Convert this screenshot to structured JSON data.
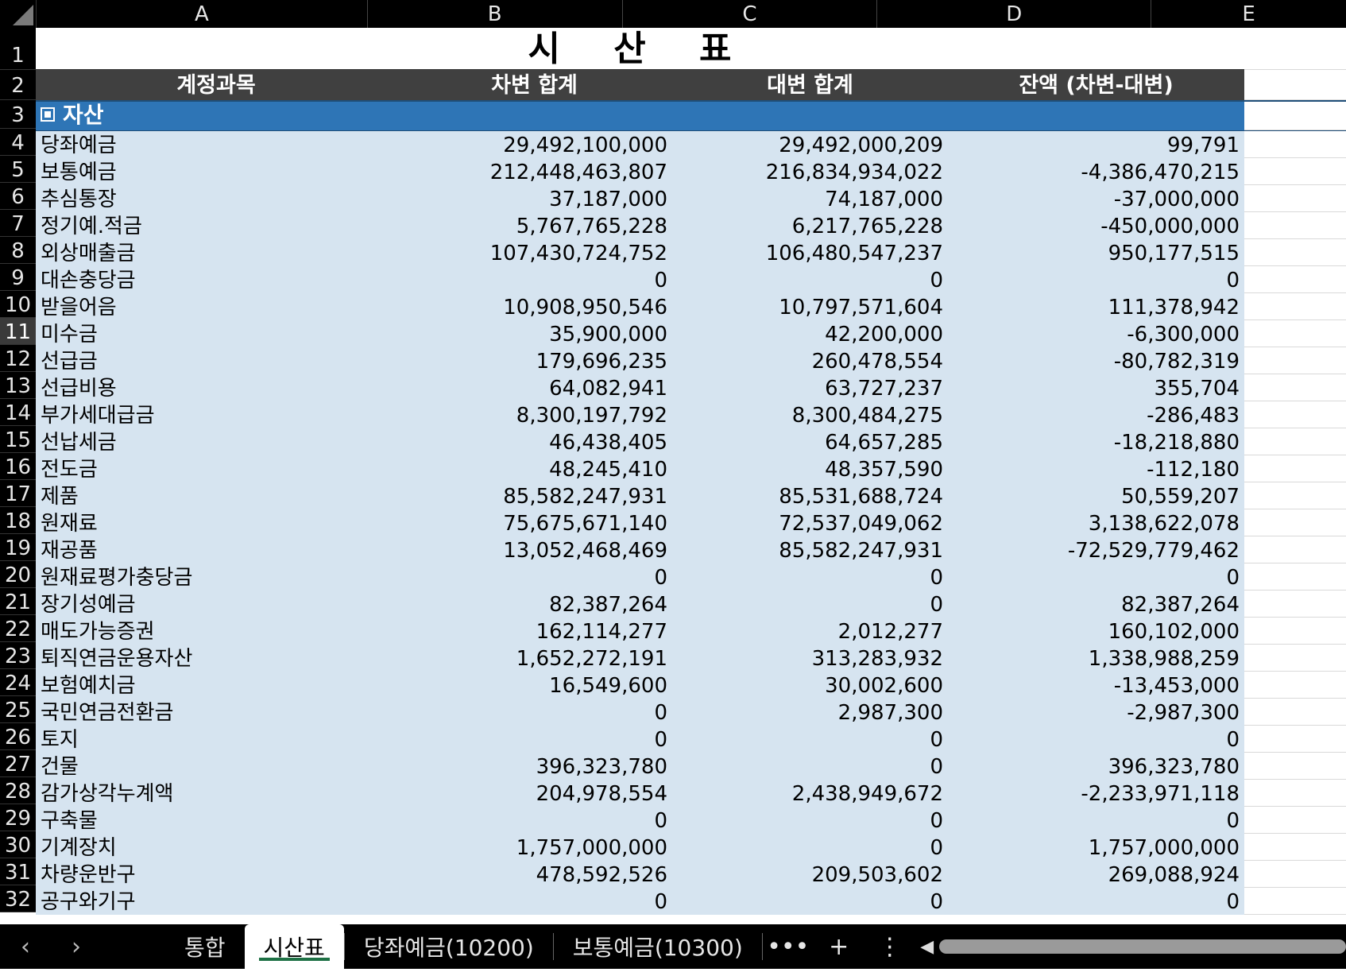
{
  "columns": [
    "A",
    "B",
    "C",
    "D",
    "E"
  ],
  "title": "시 산 표",
  "headers": {
    "account": "계정과목",
    "debit": "차변 합계",
    "credit": "대변 합계",
    "balance": "잔액 (차변-대변)"
  },
  "section_label": "자산",
  "selected_row": 11,
  "row_numbers": [
    1,
    2,
    3,
    4,
    5,
    6,
    7,
    8,
    9,
    10,
    11,
    12,
    13,
    14,
    15,
    16,
    17,
    18,
    19,
    20,
    21,
    22,
    23,
    24,
    25,
    26,
    27,
    28,
    29,
    30,
    31,
    32
  ],
  "rows": [
    {
      "account": "당좌예금",
      "debit": "29,492,100,000",
      "credit": "29,492,000,209",
      "balance": "99,791"
    },
    {
      "account": "보통예금",
      "debit": "212,448,463,807",
      "credit": "216,834,934,022",
      "balance": "-4,386,470,215"
    },
    {
      "account": "추심통장",
      "debit": "37,187,000",
      "credit": "74,187,000",
      "balance": "-37,000,000"
    },
    {
      "account": "정기예.적금",
      "debit": "5,767,765,228",
      "credit": "6,217,765,228",
      "balance": "-450,000,000"
    },
    {
      "account": "외상매출금",
      "debit": "107,430,724,752",
      "credit": "106,480,547,237",
      "balance": "950,177,515"
    },
    {
      "account": "대손충당금",
      "debit": "0",
      "credit": "0",
      "balance": "0"
    },
    {
      "account": "받을어음",
      "debit": "10,908,950,546",
      "credit": "10,797,571,604",
      "balance": "111,378,942"
    },
    {
      "account": "미수금",
      "debit": "35,900,000",
      "credit": "42,200,000",
      "balance": "-6,300,000"
    },
    {
      "account": "선급금",
      "debit": "179,696,235",
      "credit": "260,478,554",
      "balance": "-80,782,319"
    },
    {
      "account": "선급비용",
      "debit": "64,082,941",
      "credit": "63,727,237",
      "balance": "355,704"
    },
    {
      "account": "부가세대급금",
      "debit": "8,300,197,792",
      "credit": "8,300,484,275",
      "balance": "-286,483"
    },
    {
      "account": "선납세금",
      "debit": "46,438,405",
      "credit": "64,657,285",
      "balance": "-18,218,880"
    },
    {
      "account": "전도금",
      "debit": "48,245,410",
      "credit": "48,357,590",
      "balance": "-112,180"
    },
    {
      "account": "제품",
      "debit": "85,582,247,931",
      "credit": "85,531,688,724",
      "balance": "50,559,207"
    },
    {
      "account": "원재료",
      "debit": "75,675,671,140",
      "credit": "72,537,049,062",
      "balance": "3,138,622,078"
    },
    {
      "account": "재공품",
      "debit": "13,052,468,469",
      "credit": "85,582,247,931",
      "balance": "-72,529,779,462"
    },
    {
      "account": "원재료평가충당금",
      "debit": "0",
      "credit": "0",
      "balance": "0"
    },
    {
      "account": "장기성예금",
      "debit": "82,387,264",
      "credit": "0",
      "balance": "82,387,264"
    },
    {
      "account": "매도가능증권",
      "debit": "162,114,277",
      "credit": "2,012,277",
      "balance": "160,102,000"
    },
    {
      "account": "퇴직연금운용자산",
      "debit": "1,652,272,191",
      "credit": "313,283,932",
      "balance": "1,338,988,259"
    },
    {
      "account": "보험예치금",
      "debit": "16,549,600",
      "credit": "30,002,600",
      "balance": "-13,453,000"
    },
    {
      "account": "국민연금전환금",
      "debit": "0",
      "credit": "2,987,300",
      "balance": "-2,987,300"
    },
    {
      "account": "토지",
      "debit": "0",
      "credit": "0",
      "balance": "0"
    },
    {
      "account": "건물",
      "debit": "396,323,780",
      "credit": "0",
      "balance": "396,323,780"
    },
    {
      "account": "감가상각누계액",
      "debit": "204,978,554",
      "credit": "2,438,949,672",
      "balance": "-2,233,971,118"
    },
    {
      "account": "구축물",
      "debit": "0",
      "credit": "0",
      "balance": "0"
    },
    {
      "account": "기계장치",
      "debit": "1,757,000,000",
      "credit": "0",
      "balance": "1,757,000,000"
    },
    {
      "account": "차량운반구",
      "debit": "478,592,526",
      "credit": "209,503,602",
      "balance": "269,088,924"
    },
    {
      "account": "공구와기구",
      "debit": "0",
      "credit": "0",
      "balance": "0"
    }
  ],
  "tabs": [
    {
      "label": "통합",
      "active": false
    },
    {
      "label": "시산표",
      "active": true
    },
    {
      "label": "당좌예금(10200)",
      "active": false
    },
    {
      "label": "보통예금(10300)",
      "active": false
    }
  ],
  "toolbar": {
    "prev": "‹",
    "next": "›",
    "more": "•••",
    "add": "+",
    "menu": "⋮",
    "scroll_left": "◀"
  },
  "icons": [
    "prev-sheet-icon",
    "next-sheet-icon",
    "more-sheets-icon",
    "add-sheet-icon",
    "options-icon",
    "scroll-left-icon",
    "collapse-box-icon"
  ]
}
